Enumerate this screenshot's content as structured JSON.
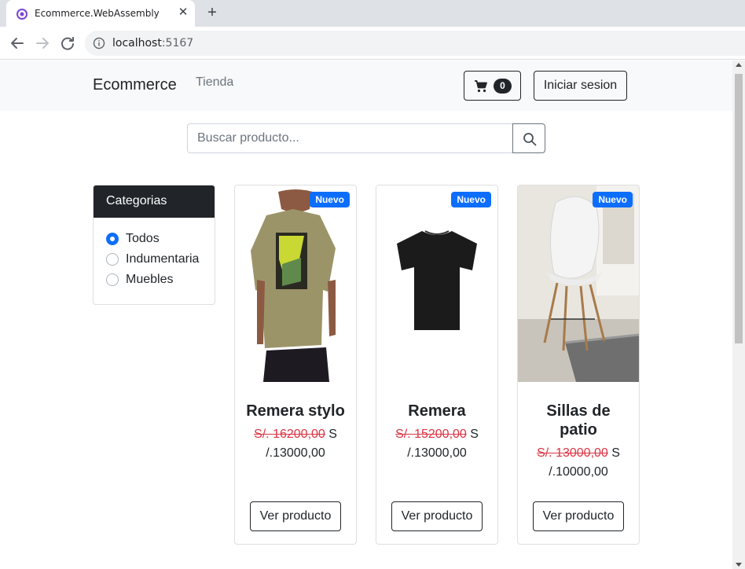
{
  "browser": {
    "tab_title": "Ecommerce.WebAssembly",
    "url_host": "localhost",
    "url_port": ":5167"
  },
  "navbar": {
    "brand": "Ecommerce",
    "link_store": "Tienda",
    "cart_count": "0",
    "login_label": "Iniciar sesion"
  },
  "search": {
    "placeholder": "Buscar producto..."
  },
  "categories": {
    "header": "Categorias",
    "items": [
      {
        "label": "Todos",
        "checked": true
      },
      {
        "label": "Indumentaria",
        "checked": false
      },
      {
        "label": "Muebles",
        "checked": false
      }
    ]
  },
  "products": [
    {
      "badge": "Nuevo",
      "title": "Remera stylo",
      "old_price": "S/. 16200,00",
      "price": " S /.13000,00",
      "button": "Ver producto"
    },
    {
      "badge": "Nuevo",
      "title": "Remera",
      "old_price": "S/. 15200,00",
      "price": " S /.13000,00",
      "button": "Ver producto"
    },
    {
      "badge": "Nuevo",
      "title": "Sillas de patio",
      "old_price": "S/. 13000,00",
      "price": " S /.10000,00",
      "button": "Ver producto"
    }
  ],
  "colors": {
    "primary": "#0d6efd",
    "dark": "#212529",
    "danger": "#dc3545",
    "navbar_bg": "#f8f9fa"
  }
}
